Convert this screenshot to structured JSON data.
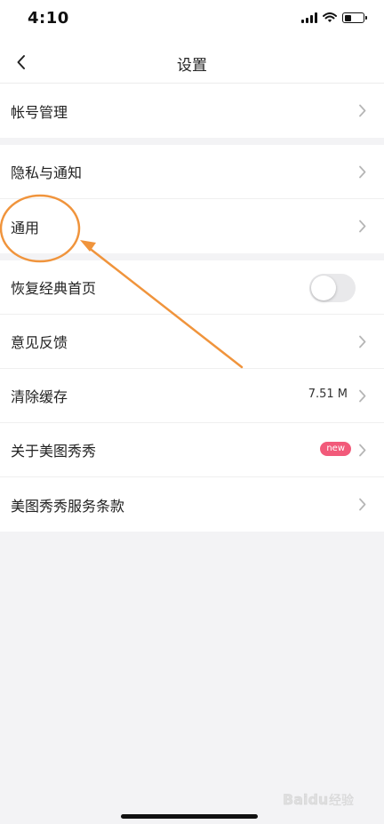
{
  "status_bar": {
    "time": "4:10",
    "battery_level": 0.35
  },
  "header": {
    "title": "设置"
  },
  "groups": [
    {
      "items": [
        {
          "label": "帐号管理"
        }
      ]
    },
    {
      "items": [
        {
          "label": "隐私与通知"
        },
        {
          "label": "通用"
        }
      ]
    },
    {
      "items": [
        {
          "label": "恢复经典首页",
          "toggle": false
        },
        {
          "label": "意见反馈"
        },
        {
          "label": "清除缓存",
          "value": "7.51 M"
        },
        {
          "label": "关于美图秀秀",
          "badge": "new"
        },
        {
          "label": "美图秀秀服务条款"
        }
      ]
    }
  ],
  "colors": {
    "annotation": "#f0943c",
    "badge": "#f25a7a",
    "background": "#f3f3f5"
  },
  "watermark": {
    "text": "Baidu 经验"
  }
}
